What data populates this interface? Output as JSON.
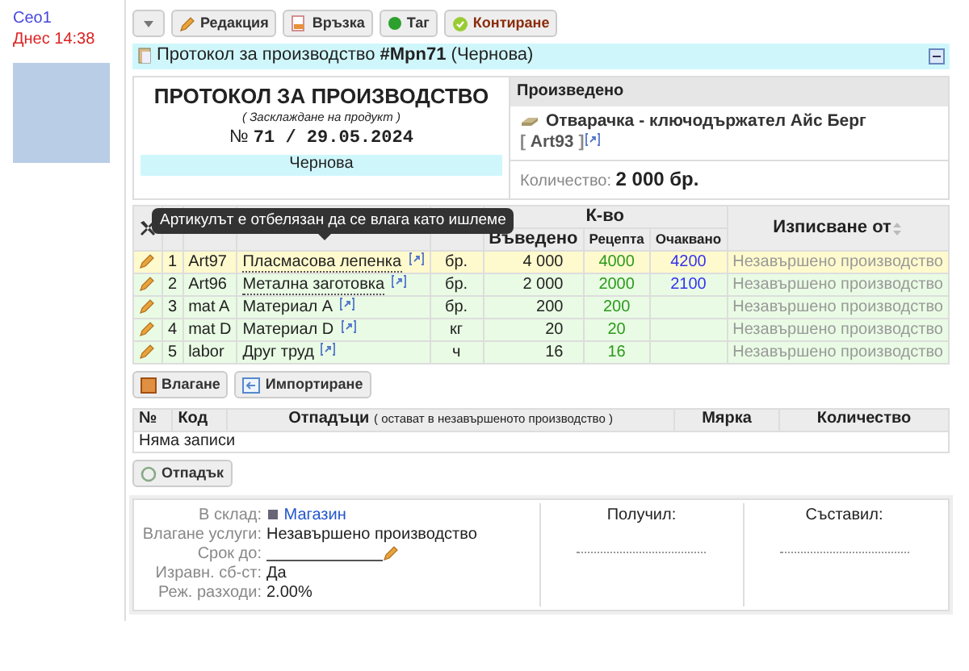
{
  "user": {
    "name": "Ceo1",
    "time": "Днес 14:38"
  },
  "toolbar": [
    {
      "kind": "dropdown"
    },
    {
      "kind": "edit",
      "label": "Редакция"
    },
    {
      "kind": "link",
      "label": "Връзка"
    },
    {
      "kind": "tag",
      "label": "Таг"
    },
    {
      "kind": "post",
      "label": "Контиране"
    }
  ],
  "title": "Протокол за производство **#Mpn71** (Чернова)",
  "document": {
    "heading": "ПРОТОКОЛ ЗА ПРОИЗВОДСТВО",
    "subtitle": "( Засклаждане на продукт )",
    "number_sign": "№",
    "number": "71",
    "separator": "/",
    "date": "29.05.2024",
    "status": "Чернова"
  },
  "produced": {
    "header": "Произведено",
    "product": "Отварачка - ключодържател Айс Берг",
    "code": "Art93",
    "code_open": "[",
    "code_close": "]",
    "quantity_label": "Количество:",
    "quantity": "2 000 бр."
  },
  "items": {
    "group_header": "К-во",
    "columns": [
      "Въведено",
      "Рецепта",
      "Очаквано",
      "Изписване от"
    ],
    "tooltip": "Артикулът е отбелязан да се влага като ишлеме",
    "rows": [
      {
        "number": "1",
        "code": "Art97",
        "name": "Пласмасова лепенка",
        "unit": "бр.",
        "entered": "4 000",
        "recipe": "4000",
        "expected": "4200",
        "source": "Незавършено производство",
        "highlighted": true,
        "flagged": true
      },
      {
        "number": "2",
        "code": "Art96",
        "name": "Метална заготовка",
        "unit": "бр.",
        "entered": "2 000",
        "recipe": "2000",
        "expected": "2100",
        "source": "Незавършено производство",
        "highlighted": false,
        "flagged": true
      },
      {
        "number": "3",
        "code": "mat A",
        "name": "Материал A",
        "unit": "бр.",
        "entered": "200",
        "recipe": "200",
        "expected": "",
        "source": "Незавършено производство",
        "highlighted": false,
        "flagged": false
      },
      {
        "number": "4",
        "code": "mat D",
        "name": "Материал D",
        "unit": "кг",
        "entered": "20",
        "recipe": "20",
        "expected": "",
        "source": "Незавършено производство",
        "highlighted": false,
        "flagged": false
      },
      {
        "number": "5",
        "code": "labor",
        "name": "Друг труд",
        "unit": "ч",
        "entered": "16",
        "recipe": "16",
        "expected": "",
        "source": "Незавършено производство",
        "highlighted": false,
        "flagged": false
      }
    ],
    "buttons": [
      {
        "kind": "input",
        "label": "Влагане"
      },
      {
        "kind": "import",
        "label": "Импортиране"
      }
    ]
  },
  "waste": {
    "columns": [
      "№",
      "Код",
      "Отпадъци",
      "Мярка",
      "Количество"
    ],
    "note": "( остават в незавършеното производство )",
    "empty": "Няма записи",
    "button": "Отпадък"
  },
  "footer": {
    "fields": [
      {
        "kind": "store",
        "label": "В склад:",
        "value": "Магазин"
      },
      {
        "kind": "text",
        "label": "Влагане услуги:",
        "value": "Незавършено производство"
      },
      {
        "kind": "date",
        "label": "Срок до:"
      },
      {
        "kind": "text",
        "label": "Изравн. сб-ст:",
        "value": "Да"
      },
      {
        "kind": "text",
        "label": "Реж. разходи:",
        "value": "2.00%"
      }
    ],
    "signatures": [
      "Получил:",
      "Съставил:"
    ]
  }
}
